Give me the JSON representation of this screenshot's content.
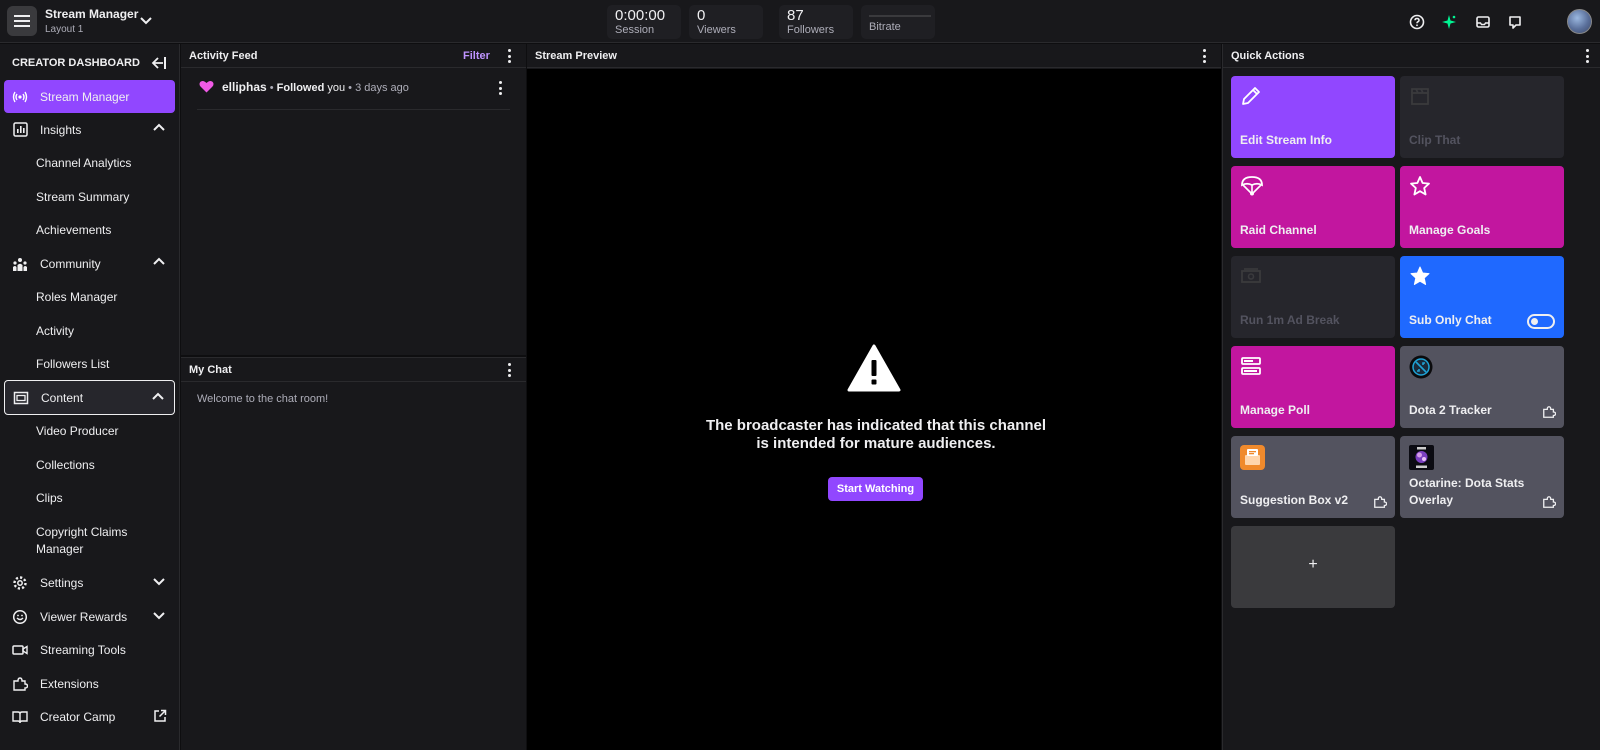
{
  "app": {
    "title": "Stream Manager",
    "layout": "Layout 1"
  },
  "stats": [
    {
      "value": "0:00:00",
      "label": "Session"
    },
    {
      "value": "0",
      "label": "Viewers"
    },
    {
      "value": "87",
      "label": "Followers"
    },
    {
      "value": "",
      "label": "Bitrate"
    }
  ],
  "sidebar": {
    "header": "CREATOR DASHBOARD",
    "stream_manager": "Stream Manager",
    "insights": {
      "label": "Insights",
      "items": [
        "Channel Analytics",
        "Stream Summary",
        "Achievements"
      ]
    },
    "community": {
      "label": "Community",
      "items": [
        "Roles Manager",
        "Activity",
        "Followers List"
      ]
    },
    "content": {
      "label": "Content",
      "items": [
        "Video Producer",
        "Collections",
        "Clips",
        "Copyright Claims",
        "Manager"
      ]
    },
    "settings": "Settings",
    "viewer_rewards": "Viewer Rewards",
    "streaming_tools": "Streaming Tools",
    "extensions": "Extensions",
    "creator_camp": "Creator Camp"
  },
  "activity_feed": {
    "title": "Activity Feed",
    "filter": "Filter",
    "item": {
      "user": "elliphas",
      "sep1": " • ",
      "action_bold": "Followed",
      "action_rest": " you",
      "sep2": " • ",
      "time": "3 days ago"
    }
  },
  "chat": {
    "title": "My Chat",
    "welcome": "Welcome to the chat room!"
  },
  "preview": {
    "title": "Stream Preview",
    "line1": "The broadcaster has indicated that this channel",
    "line2": "is intended for mature audiences.",
    "button": "Start Watching"
  },
  "quick_actions": {
    "title": "Quick Actions",
    "tiles": [
      {
        "label": "Edit Stream Info",
        "color": "#9147ff",
        "icon": "pencil-icon"
      },
      {
        "label": "Clip That",
        "color": "#26262c",
        "icon": "clapperboard-icon"
      },
      {
        "label": "Raid Channel",
        "color": "#c2169f",
        "icon": "parachute-icon"
      },
      {
        "label": "Manage Goals",
        "color": "#c2169f",
        "icon": "star-outline-icon"
      },
      {
        "label": "Run 1m Ad Break",
        "color": "#26262c",
        "icon": "money-icon"
      },
      {
        "label": "Sub Only Chat",
        "color": "#1f69ff",
        "icon": "star-icon"
      },
      {
        "label": "Manage Poll",
        "color": "#c2169f",
        "icon": "poll-icon"
      },
      {
        "label": "Dota 2 Tracker",
        "color": "#53535f",
        "icon": "dota-icon"
      },
      {
        "label": "Suggestion Box v2",
        "color": "#53535f",
        "icon": "suggestion-box-icon"
      },
      {
        "label": "Octarine: Dota Stats Overlay",
        "color": "#53535f",
        "icon": "octarine-icon"
      },
      {
        "label": "+",
        "color": "#3a3a3d",
        "icon": "plus-icon"
      }
    ]
  }
}
